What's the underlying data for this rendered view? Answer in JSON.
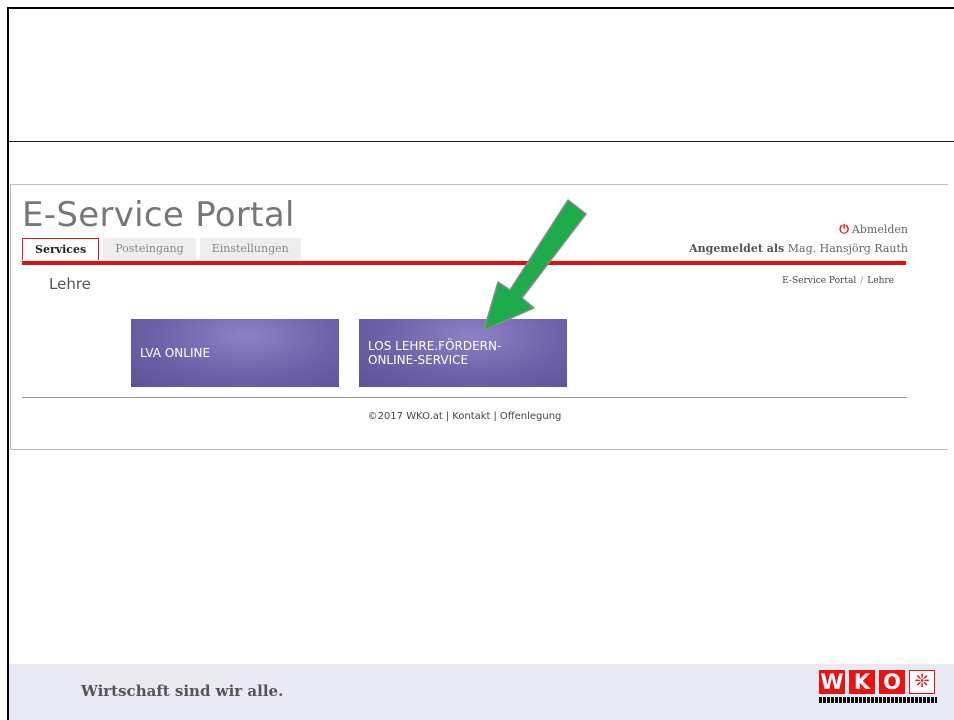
{
  "portal": {
    "title": "E-Service Portal",
    "tabs": [
      {
        "label": "Services",
        "active": true
      },
      {
        "label": "Posteingang",
        "active": false
      },
      {
        "label": "Einstellungen",
        "active": false
      }
    ],
    "logout_label": "Abmelden",
    "logged_in_prefix": "Angemeldet als",
    "user_name": "Mag. Hansjörg Rauth",
    "section_title": "Lehre",
    "breadcrumb": [
      "E-Service Portal",
      "Lehre"
    ],
    "breadcrumb_separator": "/",
    "tiles": [
      {
        "line1": "LVA ONLINE",
        "line2": ""
      },
      {
        "line1": "LOS LEHRE.FÖRDERN-",
        "line2": "ONLINE-SERVICE"
      }
    ],
    "footer": {
      "copyright": "©2017 WKO.at",
      "links": [
        "Kontakt",
        "Offenlegung"
      ],
      "separator": "|"
    }
  },
  "slide_footer": {
    "slogan": "Wirtschaft sind wir alle.",
    "logo_letters": [
      "W",
      "K",
      "O"
    ]
  },
  "colors": {
    "accent_red": "#e10f0f",
    "tile_purple": "#6d61a8",
    "arrow_green": "#1faa4b"
  }
}
